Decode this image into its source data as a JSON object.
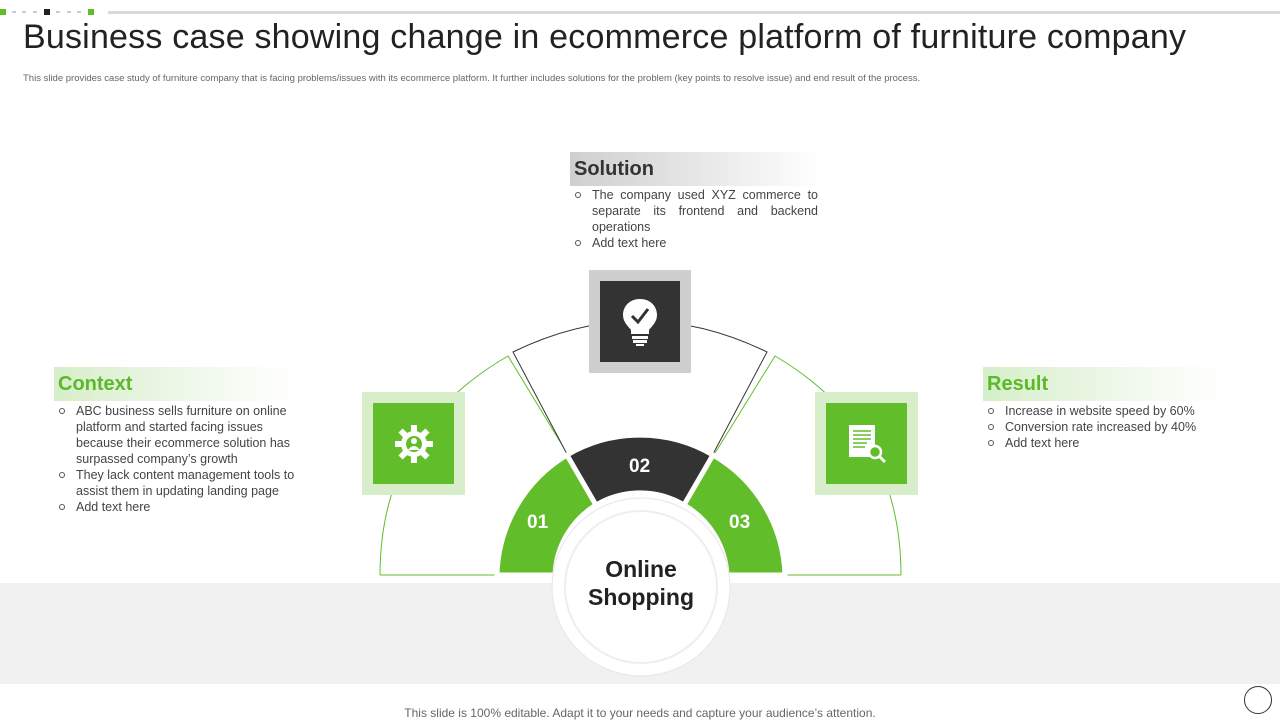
{
  "colors": {
    "accent": "#62bd2b",
    "dark": "#333333",
    "band": "#f1f1f1"
  },
  "header": {
    "title": "Business case showing change in ecommerce platform of furniture company",
    "subtitle": "This slide provides case study of furniture company that is facing problems/issues with its ecommerce platform. It further includes solutions for the problem (key points to resolve issue) and end result of the process."
  },
  "center": {
    "line1": "Online",
    "line2": "Shopping"
  },
  "segments": [
    {
      "number": "01",
      "icon": "gear-user-icon"
    },
    {
      "number": "02",
      "icon": "lightbulb-check-icon"
    },
    {
      "number": "03",
      "icon": "document-search-icon"
    }
  ],
  "context": {
    "heading": "Context",
    "items": [
      "ABC business sells furniture  on online platform and started facing issues because their ecommerce solution has surpassed company’s growth",
      "They lack content management tools to assist them in updating landing page",
      "Add text here"
    ]
  },
  "solution": {
    "heading": "Solution",
    "items": [
      "The company used XYZ commerce to separate its frontend and backend operations",
      "Add text here"
    ]
  },
  "result": {
    "heading": "Result",
    "items": [
      "Increase in website speed by 60%",
      "Conversion  rate increased by 40%",
      "Add text here"
    ]
  },
  "footer": {
    "text": "This slide is 100% editable. Adapt it to your needs and capture your audience’s attention."
  }
}
